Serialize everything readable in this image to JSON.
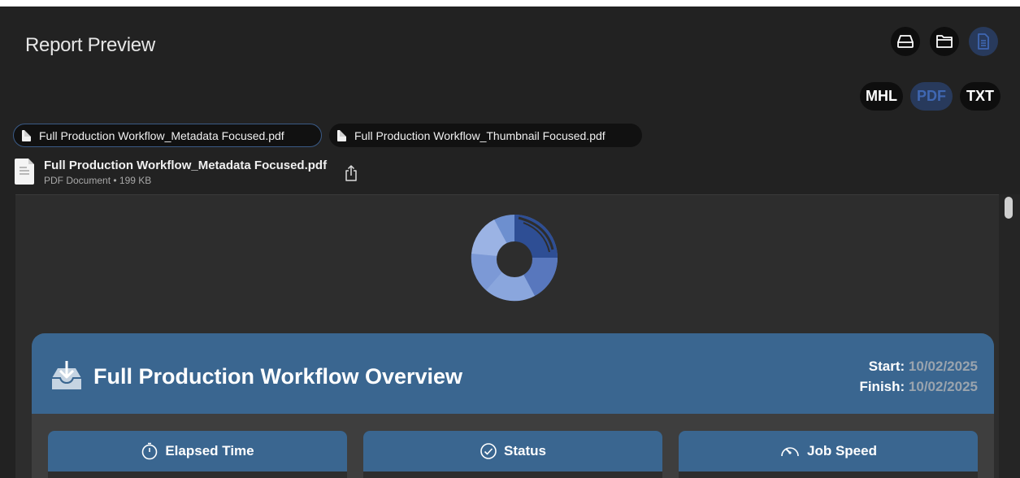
{
  "header": {
    "title": "Report Preview",
    "view_icons": [
      "drive-icon",
      "folder-icon",
      "document-icon"
    ],
    "formats": [
      "MHL",
      "PDF",
      "TXT"
    ],
    "active_format": "PDF"
  },
  "tabs": [
    {
      "label": "Full Production Workflow_Metadata Focused.pdf",
      "active": true
    },
    {
      "label": "Full Production Workflow_Thumbnail Focused.pdf",
      "active": false
    }
  ],
  "file": {
    "name": "Full Production Workflow_Metadata Focused.pdf",
    "meta": "PDF Document • 199 KB"
  },
  "report": {
    "title": "Full Production Workflow Overview",
    "start_label": "Start:",
    "start_value": "10/02/2025",
    "finish_label": "Finish:",
    "finish_value": "10/02/2025",
    "panels": [
      {
        "label": "Elapsed Time",
        "icon": "stopwatch-icon"
      },
      {
        "label": "Status",
        "icon": "checkmark-circle-icon"
      },
      {
        "label": "Job Speed",
        "icon": "speedometer-icon"
      }
    ]
  },
  "colors": {
    "accent": "#3a6690",
    "background": "#222222",
    "active_pill": "#283a5c"
  }
}
